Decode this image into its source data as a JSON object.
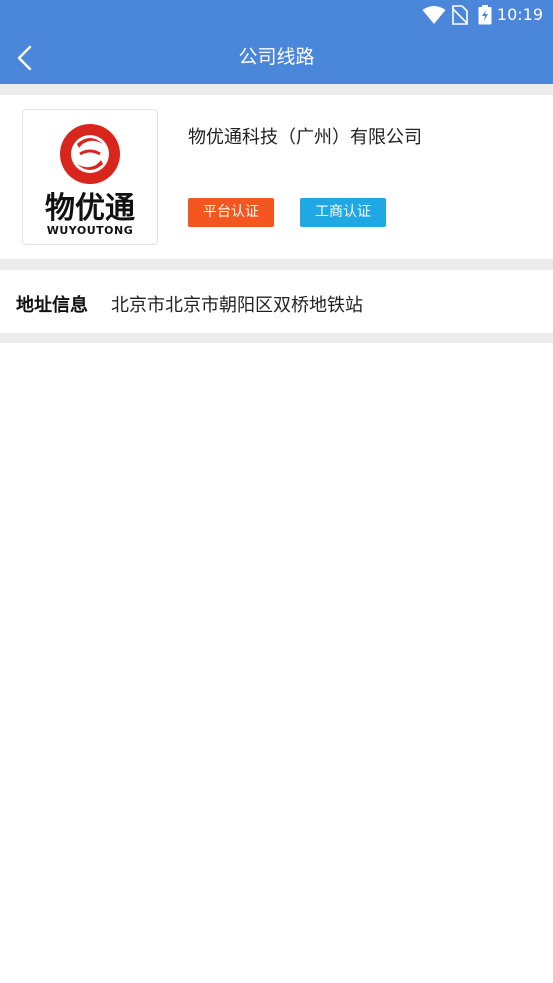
{
  "status_bar": {
    "time": "10:19",
    "icons": [
      "wifi-icon",
      "no-sim-icon",
      "battery-charging-icon"
    ]
  },
  "app_bar": {
    "back_icon": "chevron-left-icon",
    "title": "公司线路"
  },
  "company": {
    "name": "物优通科技（广州）有限公司",
    "logo": {
      "chinese_text": "物优通",
      "latin_text": "WUYOUTONG",
      "brand_color": "#d9261c"
    },
    "badges": [
      {
        "label": "平台认证",
        "color": "#f4561f"
      },
      {
        "label": "工商认证",
        "color": "#1fa8e3"
      }
    ]
  },
  "address": {
    "label": "地址信息",
    "value": "北京市北京市朝阳区双桥地铁站"
  },
  "colors": {
    "header_bg": "#4a86d9",
    "divider": "#ececec"
  }
}
